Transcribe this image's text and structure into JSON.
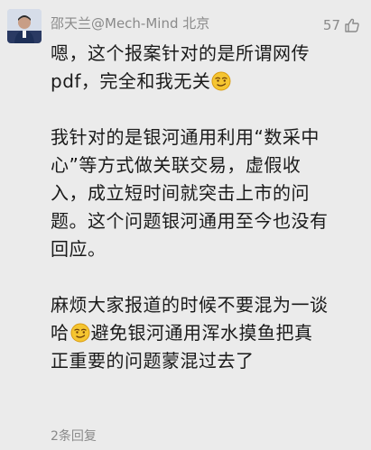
{
  "comment": {
    "author": "邵天兰@Mech-Mind 北京",
    "like_count": "57",
    "paragraphs": [
      {
        "lines": [
          {
            "text": "嗯，这个报案针对的是所谓网传"
          },
          {
            "text": "pdf，完全和我无关",
            "emoji_after": "smirk-emoji"
          }
        ]
      },
      {
        "lines": [
          {
            "text": "我针对的是银河通用利用“数采中"
          },
          {
            "text": "心”等方式做关联交易，虚假收"
          },
          {
            "text": "入，成立短时间就突击上市的问"
          },
          {
            "text": "题。这个问题银河通用至今也没有"
          },
          {
            "text": "回应。"
          }
        ]
      },
      {
        "lines": [
          {
            "text": "麻烦大家报道的时候不要混为一谈"
          },
          {
            "text_before": "哈",
            "emoji_mid": "smirk-emoji",
            "text": "避免银河通用浑水摸鱼把真"
          },
          {
            "text": "正重要的问题蒙混过去了"
          }
        ]
      }
    ],
    "reply_count_label": "2条回复"
  },
  "colors": {
    "background": "#ebebeb",
    "meta_text": "#8a8a8a",
    "body_text": "#1a1a1a",
    "emoji_face": "#f5c531"
  }
}
